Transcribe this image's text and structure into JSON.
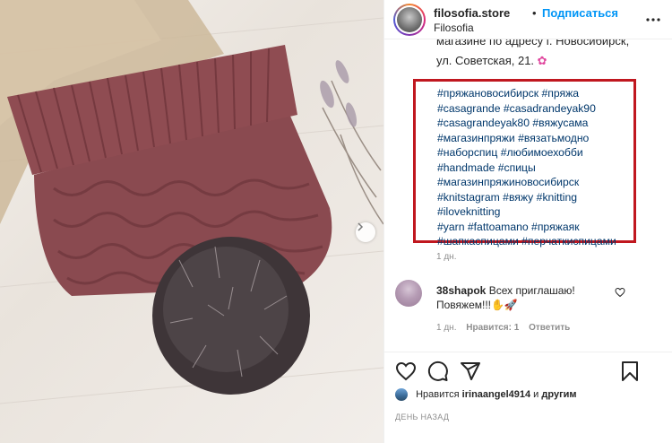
{
  "post": {
    "username": "filosofia.store",
    "separator": "•",
    "follow_label": "Подписаться",
    "subname": "Filosofia",
    "more_icon": "more-horizontal-icon"
  },
  "caption": {
    "cut_line": "магазине по адресу г. Новосибирск,",
    "address": "ул. Советская, 21.",
    "flower_icon": "✿",
    "hashtag_lines": [
      [
        "#пряжановосибирск",
        "#пряжа"
      ],
      [
        "#casagrande",
        "#casadrandeyak90"
      ],
      [
        "#casagrandeyak80",
        "#вяжусама"
      ],
      [
        "#магазинпряжи",
        "#вязатьмодно"
      ],
      [
        "#наборспиц",
        "#любимоехобби"
      ],
      [
        "#handmade",
        "#спицы"
      ],
      [
        "#магазинпряжиновосибирск"
      ],
      [
        "#knitstagram",
        "#вяжу",
        "#knitting"
      ],
      [
        "#iloveknitting"
      ],
      [
        "#yarn",
        "#fattoamano",
        "#пряжаяк"
      ],
      [
        "#шапкаспицами",
        "#перчаткиспицами"
      ]
    ],
    "time": "1 дн."
  },
  "comment": {
    "username": "38shapok",
    "text": "Всех приглашаю! Повяжем!!!✋🚀",
    "time": "1 дн.",
    "likes": "Нравится: 1",
    "reply_label": "Ответить"
  },
  "likes_line": {
    "prefix": "Нравится",
    "user": "irinaangel4914",
    "suffix": "и",
    "others": "другим"
  },
  "date": "ДЕНЬ НАЗАД",
  "colors": {
    "accent": "#0095f6",
    "hashtag": "#00376b",
    "highlight_box": "#c0171f",
    "hat": "#8e4a4f"
  }
}
